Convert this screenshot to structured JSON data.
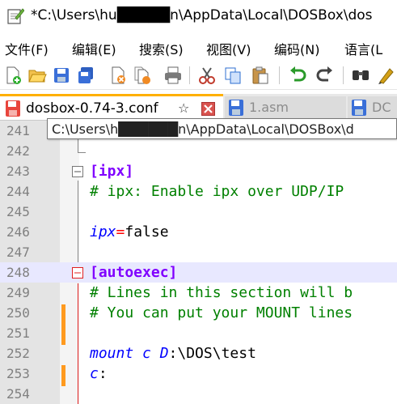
{
  "window": {
    "title": "*C:\\Users\\hu█████n\\AppData\\Local\\DOSBox\\dos"
  },
  "menu": [
    "文件(F)",
    "编辑(E)",
    "搜索(S)",
    "视图(V)",
    "编码(N)",
    "语言(L"
  ],
  "toolbar": {
    "icons": [
      "new-icon",
      "open-icon",
      "save-icon",
      "save-all-icon",
      "close-icon",
      "close-all-icon",
      "print-icon",
      "cut-icon",
      "copy-icon",
      "paste-icon",
      "undo-icon",
      "redo-icon",
      "find-icon",
      "replace-icon"
    ]
  },
  "tabs": [
    {
      "label": "dosbox-0.74-3.conf",
      "active": true
    },
    {
      "label": "1.asm",
      "active": false
    },
    {
      "label": "DC",
      "active": false
    }
  ],
  "tooltip": "C:\\Users\\h██████n\\AppData\\Local\\DOSBox\\d",
  "lines": [
    {
      "num": "241",
      "text": ""
    },
    {
      "num": "242",
      "text": ""
    },
    {
      "num": "243",
      "section": "[ipx]"
    },
    {
      "num": "244",
      "comment": "# ipx: Enable ipx over UDP/IP"
    },
    {
      "num": "245",
      "text": ""
    },
    {
      "num": "246",
      "key": "ipx",
      "op": "=",
      "val": "false"
    },
    {
      "num": "247",
      "text": ""
    },
    {
      "num": "248",
      "section": "[autoexec]"
    },
    {
      "num": "249",
      "comment": "# Lines in this section will b"
    },
    {
      "num": "250",
      "comment": "# You can put your MOUNT lines"
    },
    {
      "num": "251",
      "text": ""
    },
    {
      "num": "252",
      "cmd1": "mount c D",
      "cmd2": ":\\DOS\\test"
    },
    {
      "num": "253",
      "cmd1": "c",
      "cmd2": ":"
    },
    {
      "num": "254",
      "text": ""
    }
  ],
  "colors": {
    "section": "#8000ff",
    "comment": "#008000",
    "keyword": "#0000ff",
    "operator": "#ff0000",
    "tab_accent": "#ffb000",
    "changebar": "#ff9a1f"
  }
}
